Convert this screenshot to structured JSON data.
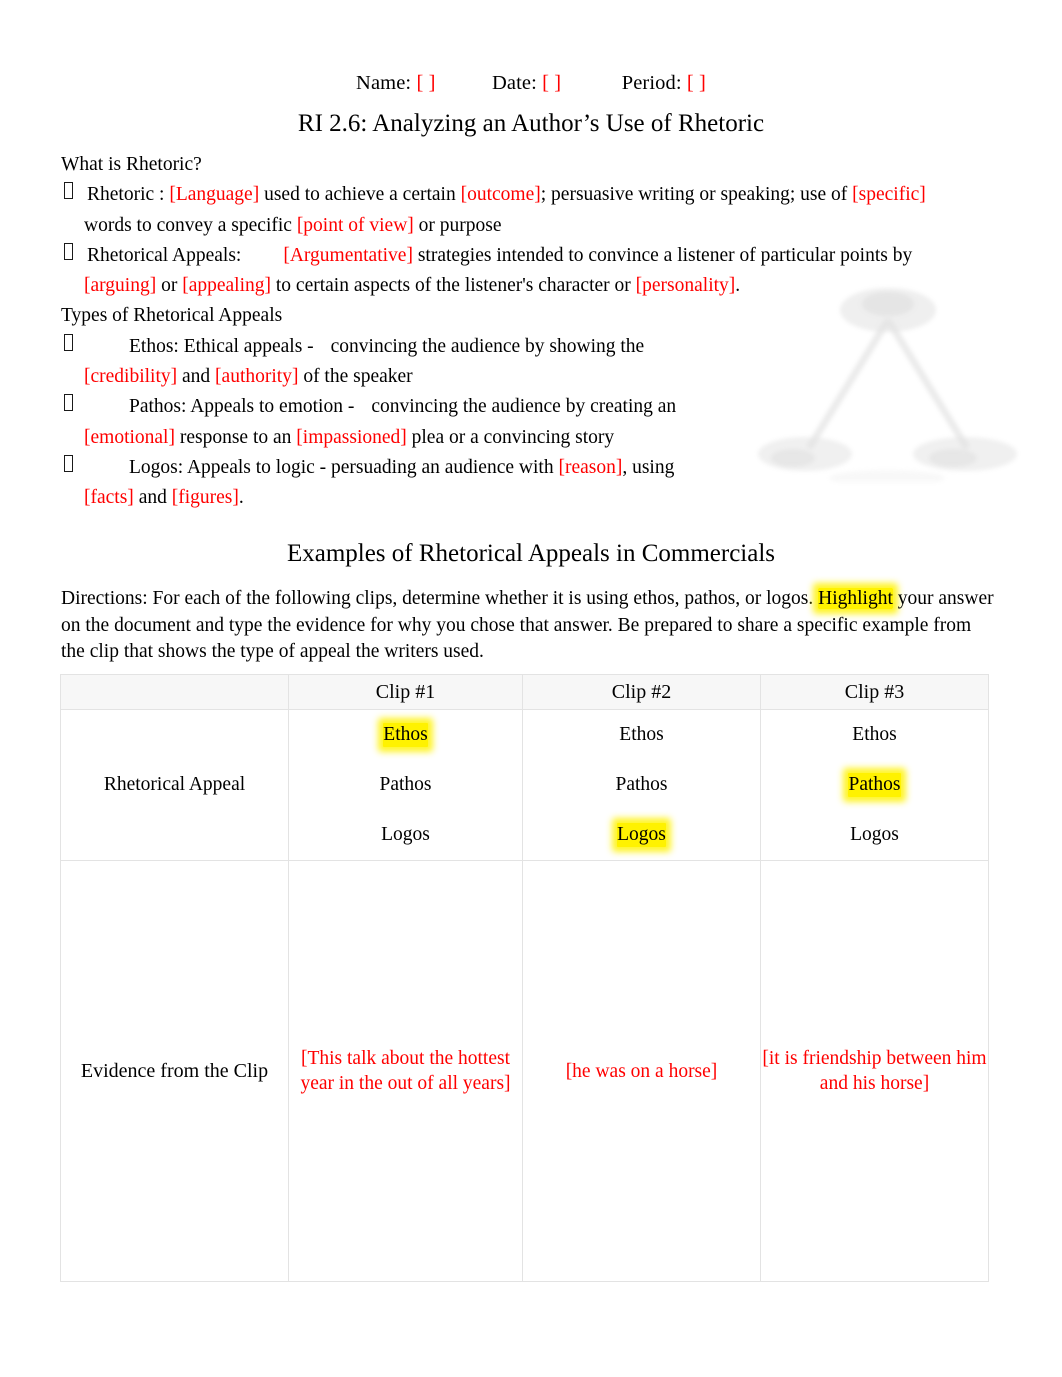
{
  "header": {
    "name_label": "Name:",
    "name_value": "[  ]",
    "date_label": "Date:",
    "date_value": "[  ]",
    "period_label": "Period:",
    "period_value": "[  ]"
  },
  "title": "RI 2.6: Analyzing an Author’s Use of Rhetoric",
  "rhetoric_section": {
    "heading": "What is Rhetoric?",
    "bullet1": {
      "p1": "Rhetoric : ",
      "r1": "[Language]",
      "p2": " used to achieve a certain ",
      "r2": "[outcome]",
      "p3": "; persuasive writing or speaking; use of ",
      "r3": "[specific]",
      "p4": "words to convey a specific ",
      "r4": "[point of view]",
      "p5": " or purpose"
    },
    "bullet2": {
      "p1": "Rhetorical Appeals:",
      "r1": "[Argumentative]",
      "p2": " strategies intended to convince a listener of particular points by",
      "r2": "[arguing]",
      "p3": " or ",
      "r3": "[appealing]",
      "p4": " to certain aspects of the listener's character or ",
      "r4": "[personality]",
      "p5": "."
    }
  },
  "types_section": {
    "heading": "Types of Rhetorical Appeals",
    "ethos": {
      "p1": "Ethos: Ethical appeals -",
      "p2": "convincing the audience by showing the",
      "r1": "[credibility]",
      "p3": " and ",
      "r2": "[authority]",
      "p4": " of the speaker"
    },
    "pathos": {
      "p1": "Pathos: Appeals to emotion -",
      "p2": "convincing the audience by creating an",
      "r1": "[emotional]",
      "p3": " response to an ",
      "r2": "[impassioned]",
      "p4": " plea or a convincing story"
    },
    "logos": {
      "p1": "Logos: Appeals to logic -  persuading an audience with ",
      "r1": "[reason]",
      "p2": ", using",
      "r2": "[facts]",
      "p3": " and ",
      "r3": "[figures]",
      "p4": "."
    }
  },
  "examples_section": {
    "heading": "Examples of Rhetorical Appeals in Commercials",
    "directions": {
      "p1": "Directions: For each of the following clips, determine whether it is using ethos, pathos, or logos. ",
      "highlight": "Highlight",
      "p2": " your answer on the document and type the evidence for why you chose that answer. Be prepared to share a specific example from the clip that shows the type of appeal the writers used."
    }
  },
  "table": {
    "headers": [
      "",
      "Clip #1",
      "Clip #2",
      "Clip #3"
    ],
    "row_labels": {
      "appeal": "Rhetorical Appeal",
      "evidence": "Evidence from the Clip"
    },
    "options": [
      "Ethos",
      "Pathos",
      "Logos"
    ],
    "clips": [
      {
        "name": "Clip #1",
        "options": [
          "Ethos",
          "Pathos",
          "Logos"
        ],
        "selected": "Ethos",
        "evidence": "[This talk about the hottest year in the out of all years]"
      },
      {
        "name": "Clip #2",
        "options": [
          "Ethos",
          "Pathos",
          "Logos"
        ],
        "selected": "Logos",
        "evidence": "[he was on a horse]"
      },
      {
        "name": "Clip #3",
        "options": [
          "Ethos",
          "Pathos",
          "Logos"
        ],
        "selected": "Pathos",
        "evidence": "[it is friendship between him and his horse]"
      }
    ]
  },
  "colors": {
    "fill_in_red": "#FF0000",
    "highlight_yellow": "#FFF200",
    "table_border": "#E3E3E3",
    "header_row_fill": "#F7F7F7"
  },
  "watermark": {
    "name": "rhetorical-triangle-image"
  }
}
